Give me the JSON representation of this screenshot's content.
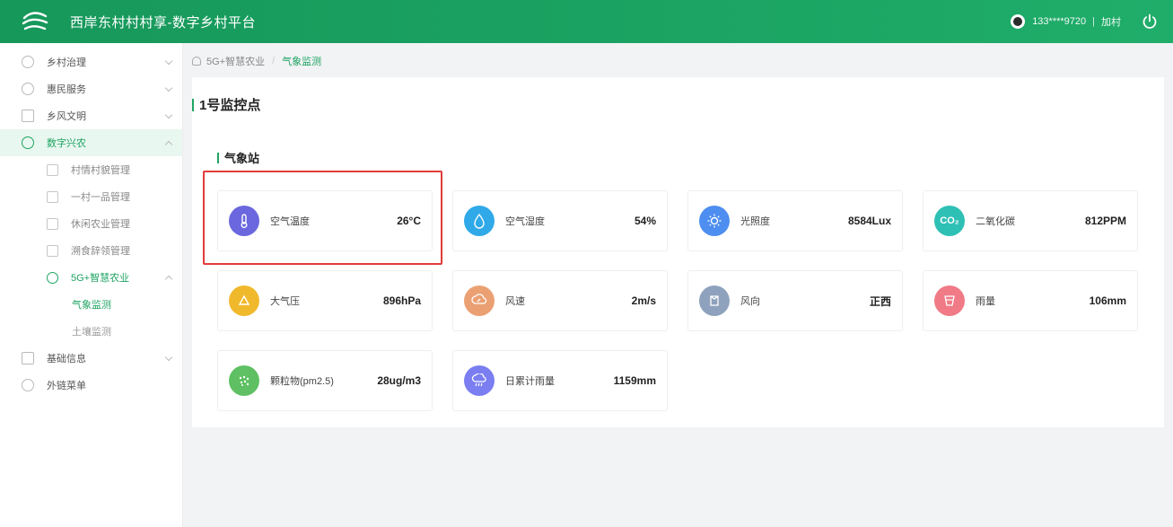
{
  "header": {
    "title": "西岸东村村村享-数字乡村平台",
    "phone": "133****9720",
    "separator": "|",
    "role": "加村"
  },
  "sidebar": {
    "items": [
      {
        "label": "乡村治理"
      },
      {
        "label": "惠民服务"
      },
      {
        "label": "乡风文明"
      },
      {
        "label": "数字兴农"
      },
      {
        "label": "村情村貌管理"
      },
      {
        "label": "一村一品管理"
      },
      {
        "label": "休闲农业管理"
      },
      {
        "label": "溯食辞领管理"
      },
      {
        "label": "5G+智慧农业"
      },
      {
        "label": "气象监测"
      },
      {
        "label": "土壤监测"
      },
      {
        "label": "基础信息"
      },
      {
        "label": "外链菜单"
      }
    ]
  },
  "breadcrumb": {
    "parent": "5G+智慧农业",
    "separator": "/",
    "current": "气象监测"
  },
  "main": {
    "point_title": "1号监控点",
    "station_title": "气象站",
    "cards": [
      {
        "label": "空气温度",
        "value": "26°C",
        "color": "#6b67de"
      },
      {
        "label": "空气湿度",
        "value": "54%",
        "color": "#2fa9e8"
      },
      {
        "label": "光照度",
        "value": "8584Lux",
        "color": "#4d8ef0"
      },
      {
        "label": "二氧化碳",
        "value": "812PPM",
        "color": "#2ec0b5",
        "icon_text": "CO₂"
      },
      {
        "label": "大气压",
        "value": "896hPa",
        "color": "#f0b92c"
      },
      {
        "label": "风速",
        "value": "2m/s",
        "color": "#eba073"
      },
      {
        "label": "风向",
        "value": "正西",
        "color": "#8fa2bd"
      },
      {
        "label": "雨量",
        "value": "106mm",
        "color": "#f07a86"
      },
      {
        "label": "颗粒物(pm2.5)",
        "value": "28ug/m3",
        "color": "#5fc063"
      },
      {
        "label": "日累计雨量",
        "value": "1159mm",
        "color": "#7a7ef0"
      }
    ]
  },
  "colors": {
    "brand": "#1fa463",
    "highlight": "#e23b3b"
  }
}
